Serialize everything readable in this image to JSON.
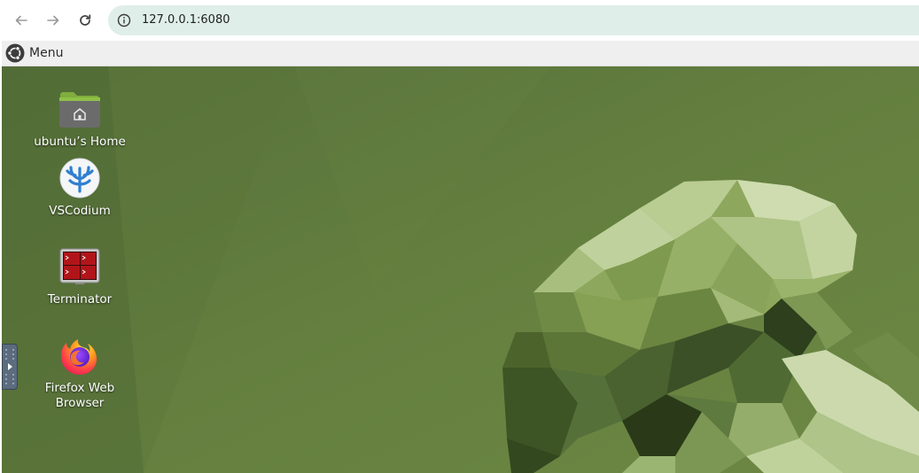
{
  "browser": {
    "url": "127.0.0.1:6080",
    "back_icon": "arrow-left-icon",
    "forward_icon": "arrow-right-icon",
    "reload_icon": "reload-icon",
    "info_icon": "info-circle-icon"
  },
  "panel": {
    "menu_label": "Menu",
    "menu_icon": "ubuntu-logo-icon"
  },
  "desktop": {
    "icons": [
      {
        "label": "ubuntu’s Home",
        "icon": "home-folder-icon"
      },
      {
        "label": "VSCodium",
        "icon": "vscodium-icon"
      },
      {
        "label": "Terminator",
        "icon": "terminator-icon"
      },
      {
        "label": "Firefox Web Browser",
        "icon": "firefox-icon"
      }
    ],
    "wallpaper_color": "#5f7a3b"
  }
}
